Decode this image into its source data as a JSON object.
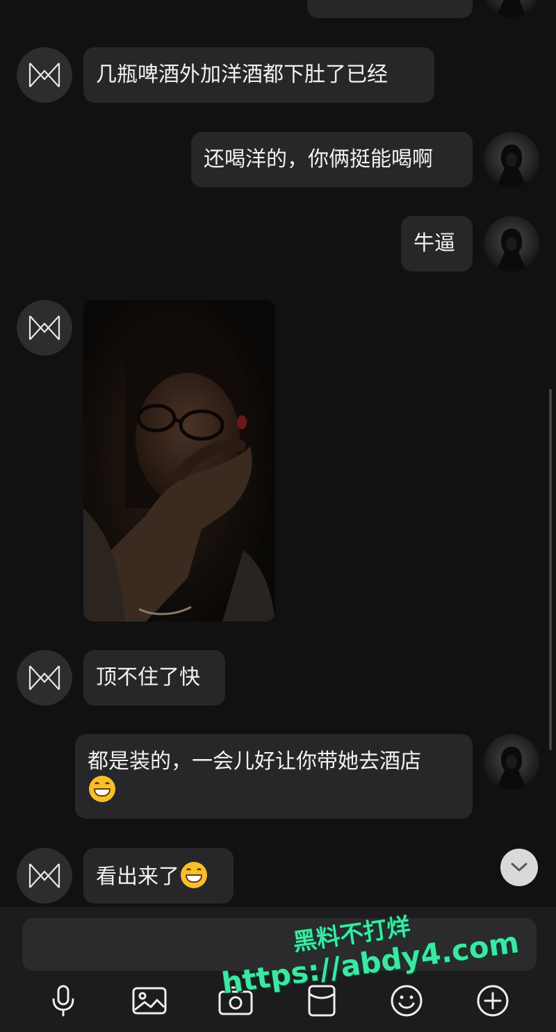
{
  "messages": [
    {
      "side": "left",
      "text": "几瓶啤酒外加洋酒都下肚了已经"
    },
    {
      "side": "right",
      "text": "还喝洋的，你俩挺能喝啊"
    },
    {
      "side": "right",
      "text": "牛逼"
    },
    {
      "side": "left",
      "type": "photo"
    },
    {
      "side": "left",
      "text": "顶不住了快"
    },
    {
      "side": "right",
      "text": "都是装的，一会儿好让你带她去酒店",
      "emoji": "grinning-face"
    },
    {
      "side": "left",
      "text": "看出来了",
      "emoji": "grinning-face"
    }
  ],
  "icons": {
    "contact_avatar": "m-logo-icon",
    "user_avatar": "hooded-figure-icon",
    "scroll_down": "chevron-down-icon",
    "toolbar": [
      "microphone-icon",
      "image-icon",
      "camera-icon",
      "red-packet-icon",
      "smiley-icon",
      "plus-circle-icon"
    ]
  },
  "input": {
    "placeholder": ""
  },
  "watermark": {
    "line1": "黑料不打烊",
    "line2": "https://abdy4.com"
  },
  "colors": {
    "background": "#111113",
    "bubble": "#27272a",
    "text": "#f2f2f2",
    "watermark": "#3ee6a2"
  }
}
